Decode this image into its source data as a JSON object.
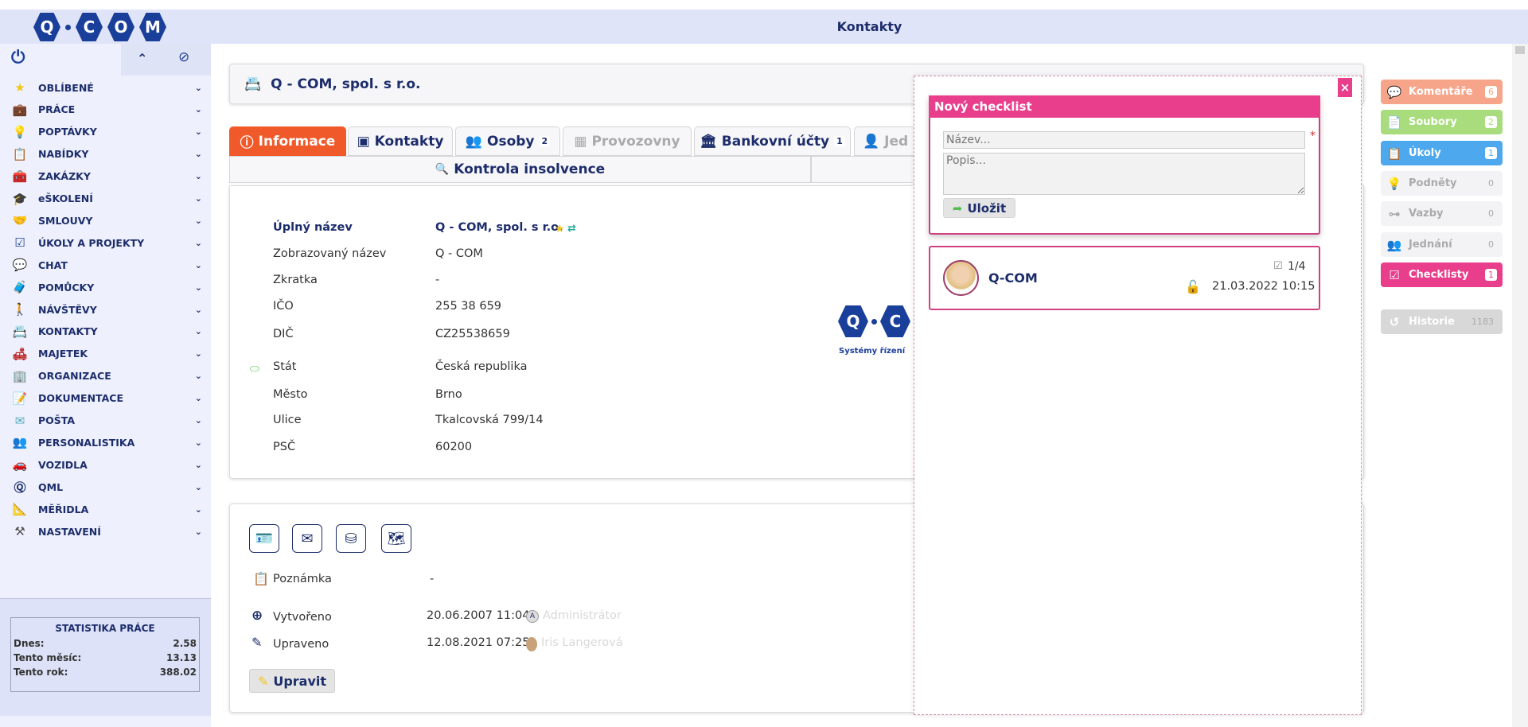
{
  "app": {
    "title": "Kontakty",
    "logo": "Q·COM"
  },
  "sidebar": {
    "items": [
      {
        "label": "OBLÍBENÉ",
        "icon": "★",
        "color": "#f5c518"
      },
      {
        "label": "PRÁCE",
        "icon": "💼",
        "color": "#a0522d"
      },
      {
        "label": "POPTÁVKY",
        "icon": "💡",
        "color": "#888"
      },
      {
        "label": "NABÍDKY",
        "icon": "📋",
        "color": "#666"
      },
      {
        "label": "ZAKÁZKY",
        "icon": "🧰",
        "color": "#5a7a8a"
      },
      {
        "label": "eŠKOLENÍ",
        "icon": "🎓",
        "color": "#333"
      },
      {
        "label": "SMLOUVY",
        "icon": "🤝",
        "color": "#888"
      },
      {
        "label": "ÚKOLY A PROJEKTY",
        "icon": "☑",
        "color": "#1d3f9a"
      },
      {
        "label": "CHAT",
        "icon": "💬",
        "color": "#3ab"
      },
      {
        "label": "POMŮCKY",
        "icon": "🧳",
        "color": "#c93"
      },
      {
        "label": "NÁVŠTĚVY",
        "icon": "🚶",
        "color": "#1d2d6b"
      },
      {
        "label": "KONTAKTY",
        "icon": "📇",
        "color": "#5a9"
      },
      {
        "label": "MAJETEK",
        "icon": "🛋",
        "color": "#b22"
      },
      {
        "label": "ORGANIZACE",
        "icon": "🏢",
        "color": "#49c"
      },
      {
        "label": "DOKUMENTACE",
        "icon": "📝",
        "color": "#d93"
      },
      {
        "label": "POŠTA",
        "icon": "✉",
        "color": "#5ab"
      },
      {
        "label": "PERSONALISTIKA",
        "icon": "👥",
        "color": "#a63"
      },
      {
        "label": "VOZIDLA",
        "icon": "🚗",
        "color": "#666"
      },
      {
        "label": "QML",
        "icon": "Ⓠ",
        "color": "#1d2d6b"
      },
      {
        "label": "MĚŘIDLA",
        "icon": "📐",
        "color": "#886"
      },
      {
        "label": "NASTAVENÍ",
        "icon": "⚒",
        "color": "#555"
      }
    ],
    "stats": {
      "title": "STATISTIKA PRÁCE",
      "rows": [
        {
          "label": "Dnes:",
          "value": "2.58"
        },
        {
          "label": "Tento měsíc:",
          "value": "13.13"
        },
        {
          "label": "Tento rok:",
          "value": "388.02"
        }
      ]
    }
  },
  "header": {
    "company": "Q - COM, spol. s r.o."
  },
  "tabs": [
    {
      "label": "Informace",
      "icon": "ⓘ"
    },
    {
      "label": "Kontakty",
      "icon": "▣"
    },
    {
      "label": "Osoby",
      "icon": "👥",
      "count": "2"
    },
    {
      "label": "Provozovny",
      "icon": "▦"
    },
    {
      "label": "Bankovní účty",
      "icon": "🏛",
      "count": "1"
    },
    {
      "label": "Jed",
      "icon": "👤"
    }
  ],
  "tabs2": [
    {
      "label": "Kontrola insolvence",
      "icon": "🔍"
    }
  ],
  "info": {
    "rows": [
      {
        "label": "Úplný název",
        "value": "Q - COM, spol. s r.o."
      },
      {
        "label": "Zobrazovaný název",
        "value": "Q - COM"
      },
      {
        "label": "Zkratka",
        "value": "-"
      },
      {
        "label": "IČO",
        "value": "255 38 659"
      },
      {
        "label": "DIČ",
        "value": "CZ25538659"
      },
      {
        "label": "Stát",
        "value": "Česká republika"
      },
      {
        "label": "Město",
        "value": "Brno"
      },
      {
        "label": "Ulice",
        "value": "Tkalcovská 799/14"
      },
      {
        "label": "PSČ",
        "value": "60200"
      }
    ],
    "logo_caption": "Systémy řízení"
  },
  "meta": {
    "note_label": "Poznámka",
    "note_value": "-",
    "created_label": "Vytvořeno",
    "created_value": "20.06.2007 11:04,",
    "created_by": "Administrátor",
    "updated_label": "Upraveno",
    "updated_value": "12.08.2021 07:25,",
    "updated_by": "Iris Langerová",
    "edit_button": "Upravit"
  },
  "checklist": {
    "title": "Nový checklist",
    "name_placeholder": "Název...",
    "desc_placeholder": "Popis...",
    "save": "Uložit",
    "close": "×",
    "item": {
      "name": "Q-COM",
      "progress": "1/4",
      "date": "21.03.2022 10:15"
    }
  },
  "right": {
    "items": [
      {
        "label": "Komentáře",
        "count": "6",
        "color": "#f7a58a",
        "icon": "💬"
      },
      {
        "label": "Soubory",
        "count": "2",
        "color": "#a8dc7c",
        "icon": "📄"
      },
      {
        "label": "Úkoly",
        "count": "1",
        "color": "#4ea8ee",
        "icon": "📋"
      },
      {
        "label": "Podněty",
        "count": "0",
        "color": "#f3f3f5",
        "icon": "💡"
      },
      {
        "label": "Vazby",
        "count": "0",
        "color": "#f3f3f5",
        "icon": "⊶"
      },
      {
        "label": "Jednání",
        "count": "0",
        "color": "#f3f3f5",
        "icon": "👥"
      },
      {
        "label": "Checklisty",
        "count": "1",
        "color": "#e83e8c",
        "icon": "☑"
      },
      {
        "label": "Historie",
        "count": "1183",
        "color": "#d8d8d8",
        "icon": "↺"
      }
    ]
  }
}
